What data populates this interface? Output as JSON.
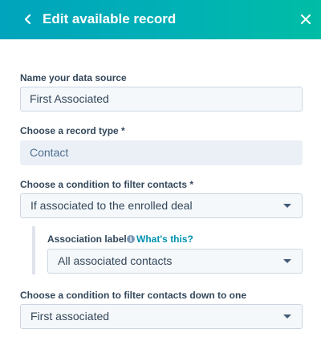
{
  "header": {
    "title": "Edit available record",
    "back_icon": "chevron-left-icon",
    "close_icon": "close-icon",
    "gradient_start": "#00a4bd",
    "gradient_end": "#00bda5"
  },
  "form": {
    "data_source": {
      "label": "Name your data source",
      "value": "First Associated"
    },
    "record_type": {
      "label": "Choose a record type *",
      "value": "Contact"
    },
    "filter_condition": {
      "label": "Choose a condition to filter contacts *",
      "selected": "If associated to the enrolled deal"
    },
    "association_label": {
      "label": "Association label",
      "help_link": "What's this?",
      "selected": "All associated contacts"
    },
    "filter_down_condition": {
      "label": "Choose a condition to filter contacts down to one",
      "selected": "First associated"
    }
  },
  "colors": {
    "link": "#0091ae",
    "text": "#33475b"
  }
}
